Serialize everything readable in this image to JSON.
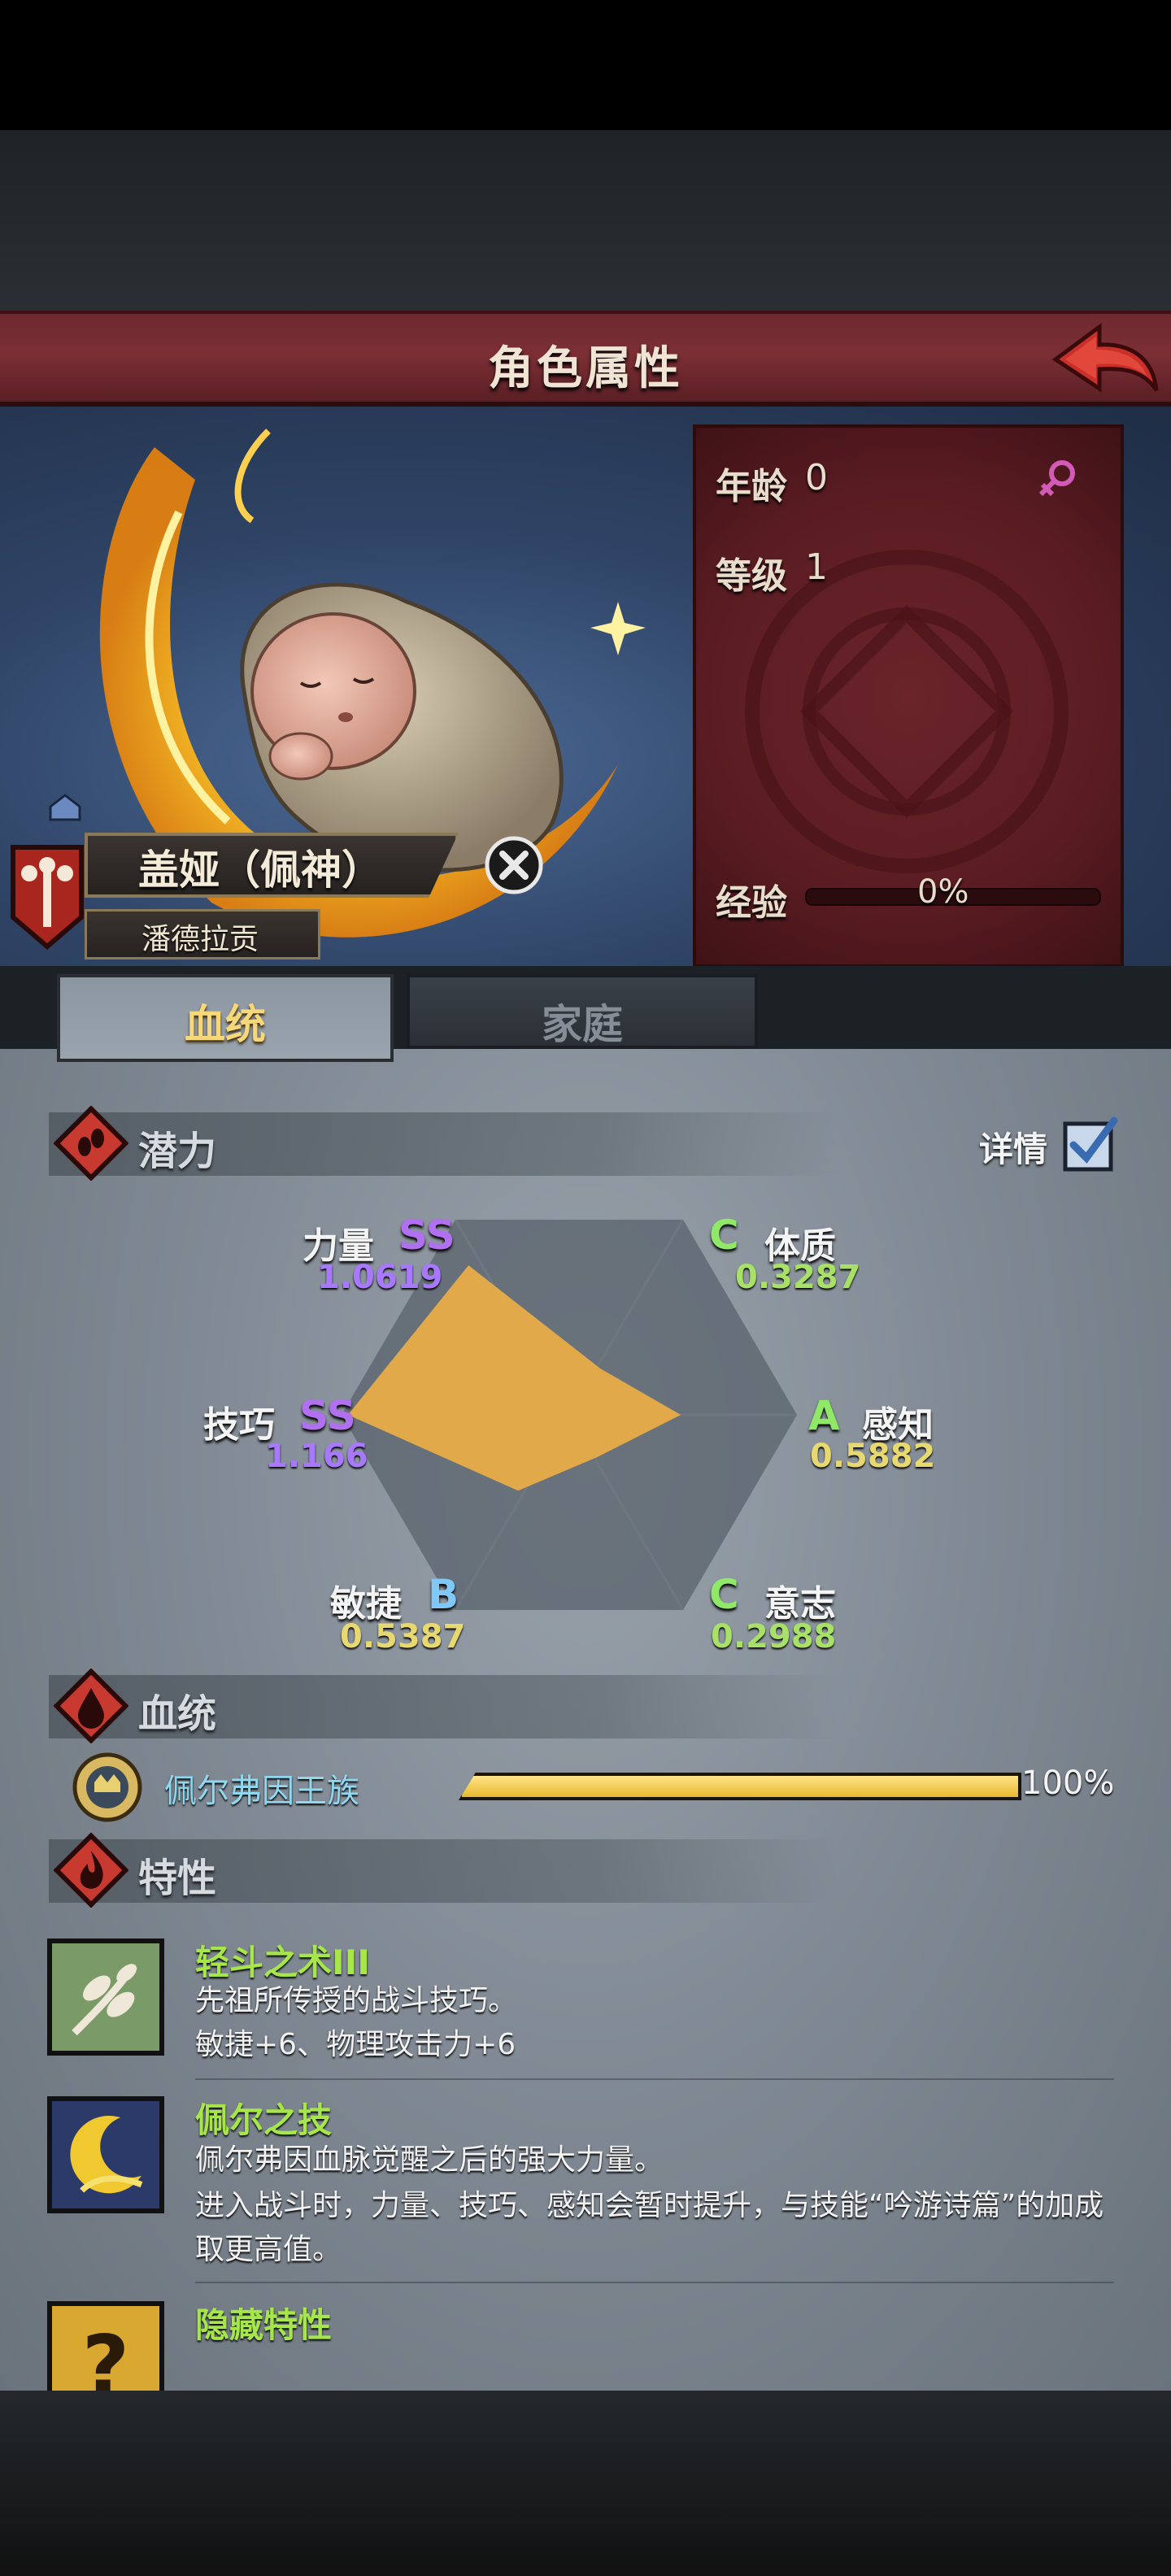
{
  "header": {
    "title": "角色属性",
    "back_icon": "back-arrow-icon"
  },
  "character": {
    "name": "盖娅（佩神）",
    "family": "潘德拉贡",
    "info": {
      "age_label": "年龄",
      "age_value": "0",
      "level_label": "等级",
      "level_value": "1",
      "exp_label": "经验",
      "exp_value": "0%",
      "exp_progress": 0,
      "gender_icon": "female-icon"
    }
  },
  "tabs": [
    {
      "label": "血统",
      "active": true
    },
    {
      "label": "家庭",
      "active": false
    }
  ],
  "potential": {
    "title": "潜力",
    "detail_label": "详情",
    "detail_checked": true,
    "stats": [
      {
        "name": "力量",
        "grade": "SS",
        "value": "1.0619"
      },
      {
        "name": "体质",
        "grade": "C",
        "value": "0.3287"
      },
      {
        "name": "感知",
        "grade": "A",
        "value": "0.5882"
      },
      {
        "name": "意志",
        "grade": "C",
        "value": "0.2988"
      },
      {
        "name": "敏捷",
        "grade": "B",
        "value": "0.5387"
      },
      {
        "name": "技巧",
        "grade": "SS",
        "value": "1.166"
      }
    ]
  },
  "bloodline": {
    "title": "血统",
    "name": "佩尔弗因王族",
    "percent": "100%",
    "progress": 1.0
  },
  "traits": {
    "title": "特性",
    "items": [
      {
        "name": "轻斗之术III",
        "desc1": "先祖所传授的战斗技巧。",
        "desc2": "敏捷+6、物理攻击力+6",
        "icon": "leaf-branch-icon"
      },
      {
        "name": "佩尔之技",
        "desc1": "佩尔弗因血脉觉醒之后的强大力量。",
        "desc2": "进入战斗时，力量、技巧、感知会暂时提升，与技能“吟游诗篇”的加成取更高值。",
        "icon": "crescent-moon-icon"
      },
      {
        "name": "隐藏特性",
        "icon": "question-mark-icon"
      }
    ]
  },
  "colors": {
    "title_bar": "#7b2f35",
    "info_panel": "#5a1c22",
    "tab_active_text": "#f6d77a",
    "radar_fill": "#e8ac48",
    "trait_name": "#a6e64a",
    "bloodline_name": "#8fd8f0",
    "grade_SS": "#b070f0",
    "grade_A": "#8fe868",
    "grade_B": "#80c8f8",
    "grade_C": "#8fe868",
    "value_purple": "#a878ff",
    "value_yellow": "#e8d870",
    "value_green": "#a8e068"
  }
}
